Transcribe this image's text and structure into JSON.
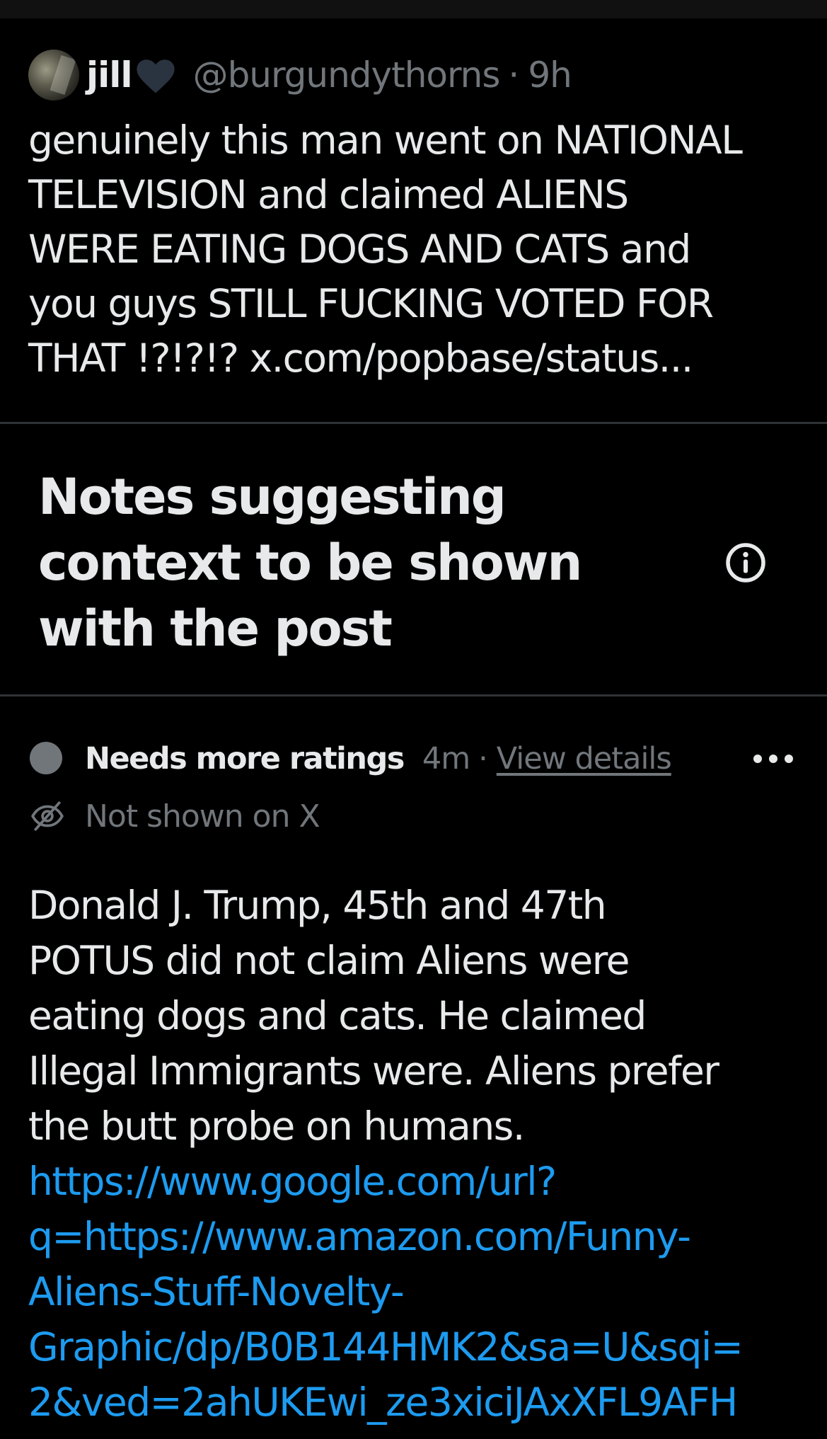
{
  "post": {
    "display_name": "jill",
    "handle": "@burgundythorns",
    "separator": "·",
    "time": "9h",
    "text_lines": [
      "genuinely this man went on NATIONAL",
      "TELEVISION and claimed ALIENS",
      "WERE EATING DOGS AND CATS  and",
      "you guys STILL FUCKING VOTED FOR",
      "THAT !?!?!? x.com/popbase/status..."
    ]
  },
  "notes_section": {
    "title_lines": [
      "Notes suggesting",
      "context to be shown",
      "with the post"
    ],
    "info_icon": "info-icon"
  },
  "note": {
    "status": "Needs more ratings",
    "age": "4m",
    "separator": "·",
    "view_details": "View details",
    "more_icon": "more-horizontal-icon",
    "visibility_icon": "eye-off-icon",
    "visibility": "Not shown on X",
    "body_lines": [
      "Donald J. Trump, 45th and 47th",
      "POTUS did not claim Aliens were",
      "eating dogs and cats. He claimed",
      "Illegal Immigrants were. Aliens prefer",
      "the butt probe on humans."
    ],
    "link_lines": [
      "https://www.google.com/url?",
      "q=https://www.amazon.com/Funny-",
      "Aliens-Stuff-Novelty-",
      "Graphic/dp/B0B144HMK2&sa=U&sqi=",
      "2&ved=2ahUKEwi_ze3xiciJAxXFL9AFH"
    ]
  },
  "colors": {
    "background": "#000000",
    "text_primary": "#e7e9ea",
    "text_secondary": "#71767b",
    "link": "#1d9bf0",
    "divider": "#2f3336",
    "heart": "#2a3440"
  }
}
